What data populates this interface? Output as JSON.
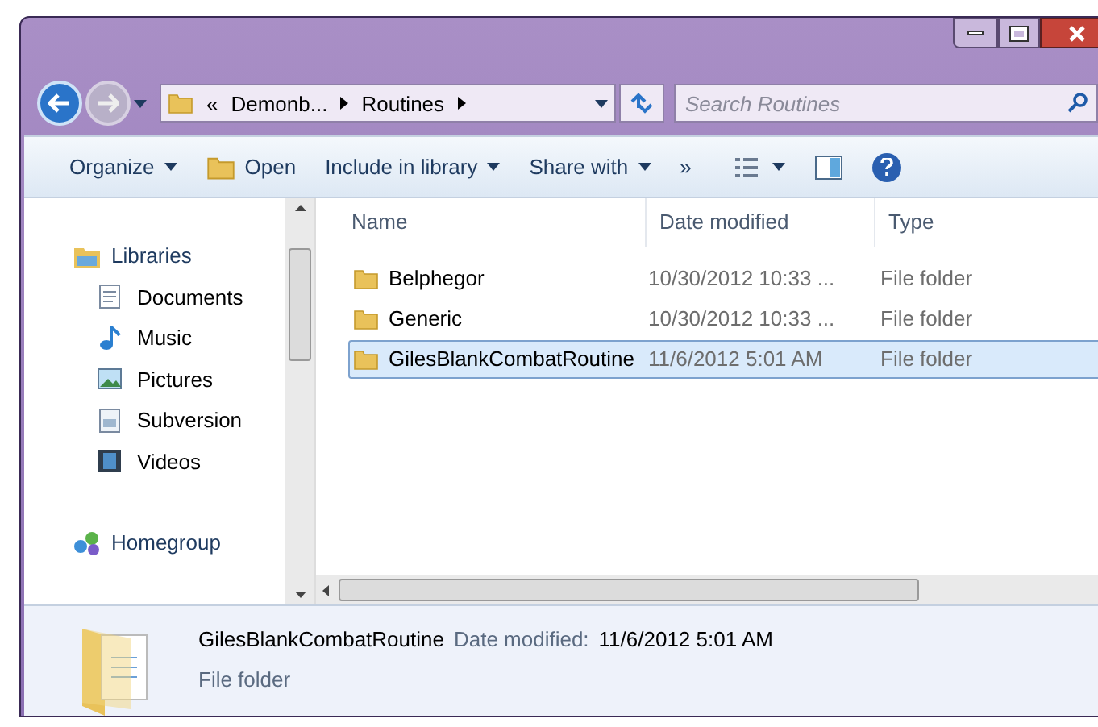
{
  "address": {
    "crumbs": [
      "«",
      "Demonb...",
      "Routines"
    ]
  },
  "search": {
    "placeholder": "Search Routines"
  },
  "toolbar": [
    {
      "kind": "menu",
      "label": "Organize"
    },
    {
      "kind": "open",
      "label": "Open"
    },
    {
      "kind": "menu",
      "label": "Include in library"
    },
    {
      "kind": "menu",
      "label": "Share with"
    },
    {
      "kind": "more",
      "label": "»"
    }
  ],
  "nav": [
    {
      "kind": "libraries",
      "label": "Libraries",
      "children": [
        {
          "kind": "documents",
          "label": "Documents"
        },
        {
          "kind": "music",
          "label": "Music"
        },
        {
          "kind": "pictures",
          "label": "Pictures"
        },
        {
          "kind": "subversion",
          "label": "Subversion"
        },
        {
          "kind": "videos",
          "label": "Videos"
        }
      ]
    },
    {
      "kind": "homegroup",
      "label": "Homegroup"
    }
  ],
  "table": {
    "columns": [
      "Name",
      "Date modified",
      "Type"
    ],
    "rows": [
      {
        "name": "Belphegor",
        "date": "10/30/2012 10:33 ...",
        "type": "File folder",
        "selected": false
      },
      {
        "name": "Generic",
        "date": "10/30/2012 10:33 ...",
        "type": "File folder",
        "selected": false
      },
      {
        "name": "GilesBlankCombatRoutine",
        "date": "11/6/2012 5:01 AM",
        "type": "File folder",
        "selected": true
      }
    ]
  },
  "details": {
    "name": "GilesBlankCombatRoutine",
    "date_label": "Date modified:",
    "date": "11/6/2012 5:01 AM",
    "type": "File folder"
  }
}
